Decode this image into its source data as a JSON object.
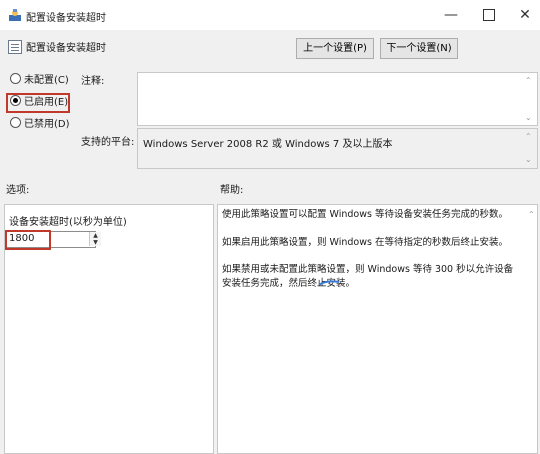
{
  "window": {
    "title": "配置设备安装超时",
    "min_glyph": "—",
    "close_glyph": "✕"
  },
  "header": {
    "title": "配置设备安装超时",
    "prev_button": "上一个设置(P)",
    "next_button": "下一个设置(N)"
  },
  "state": {
    "not_configured": "未配置(C)",
    "enabled": "已启用(E)",
    "disabled": "已禁用(D)",
    "selected": "enabled"
  },
  "comment": {
    "label": "注释:",
    "value": ""
  },
  "platform": {
    "label": "支持的平台:",
    "value": "Windows Server 2008 R2 或 Windows 7 及以上版本"
  },
  "options": {
    "label": "选项:",
    "timeout_label": "设备安装超时(以秒为单位)",
    "timeout_value": "1800"
  },
  "help": {
    "label": "帮助:",
    "paragraph1": "使用此策略设置可以配置 Windows 等待设备安装任务完成的秒数。",
    "paragraph2": "如果启用此策略设置，则 Windows 在等待指定的秒数后终止安装。",
    "paragraph3": "如果禁用或未配置此策略设置，则 Windows 等待 300 秒以允许设备安装任务完成，然后终止安装。"
  },
  "icons": {
    "title_icon": "policy-icon",
    "header_icon": "setting-icon"
  },
  "colors": {
    "highlight": "#c0392b",
    "window_bg": "#f0f0f0"
  }
}
